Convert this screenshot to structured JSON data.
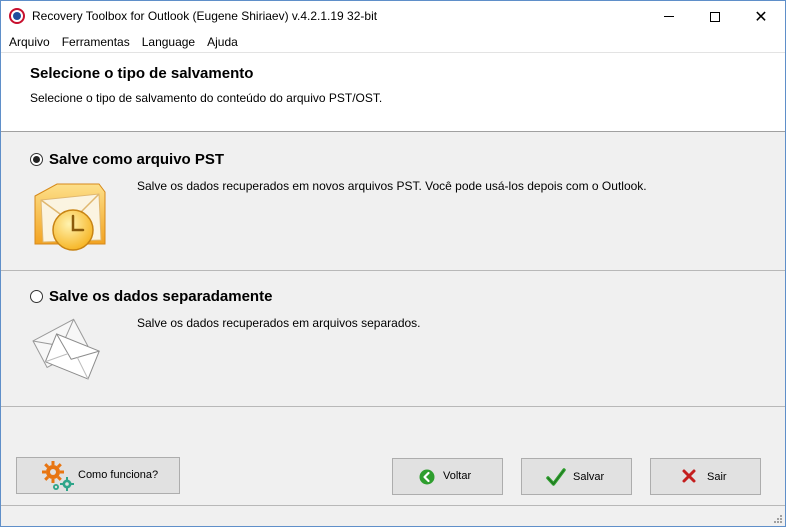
{
  "window": {
    "title": "Recovery Toolbox for Outlook (Eugene Shiriaev) v.4.2.1.19 32-bit",
    "controls": {
      "minimize_icon": "minimize-icon",
      "maximize_icon": "maximize-icon",
      "close_icon": "close-icon",
      "close_glyph": "✕"
    }
  },
  "menu": {
    "items": [
      "Arquivo",
      "Ferramentas",
      "Language",
      "Ajuda"
    ]
  },
  "header": {
    "title": "Selecione o tipo de salvamento",
    "subtitle": "Selecione o tipo de salvamento do conteúdo do arquivo PST/OST."
  },
  "options": [
    {
      "title": "Salve como arquivo PST",
      "description": "Salve os dados recuperados em novos arquivos PST.  Você pode usá-los depois com o Outlook.",
      "selected": true,
      "icon": "outlook-envelope-clock-icon"
    },
    {
      "title": "Salve os dados separadamente",
      "description": "Salve os dados recuperados em arquivos separados.",
      "selected": false,
      "icon": "envelopes-icon"
    }
  ],
  "footer": {
    "help_label": "Como funciona?",
    "back_label": "Voltar",
    "save_label": "Salvar",
    "exit_label": "Sair"
  },
  "colors": {
    "window_border": "#5f8fc9",
    "panel_bg": "#f0f0f0",
    "button_bg": "#e1e1e1",
    "back_icon": "#2e9e2e",
    "save_check": "#2ea02e",
    "exit_x": "#c41e1e",
    "gear_orange": "#e87511",
    "gear_green": "#2ea58a"
  }
}
